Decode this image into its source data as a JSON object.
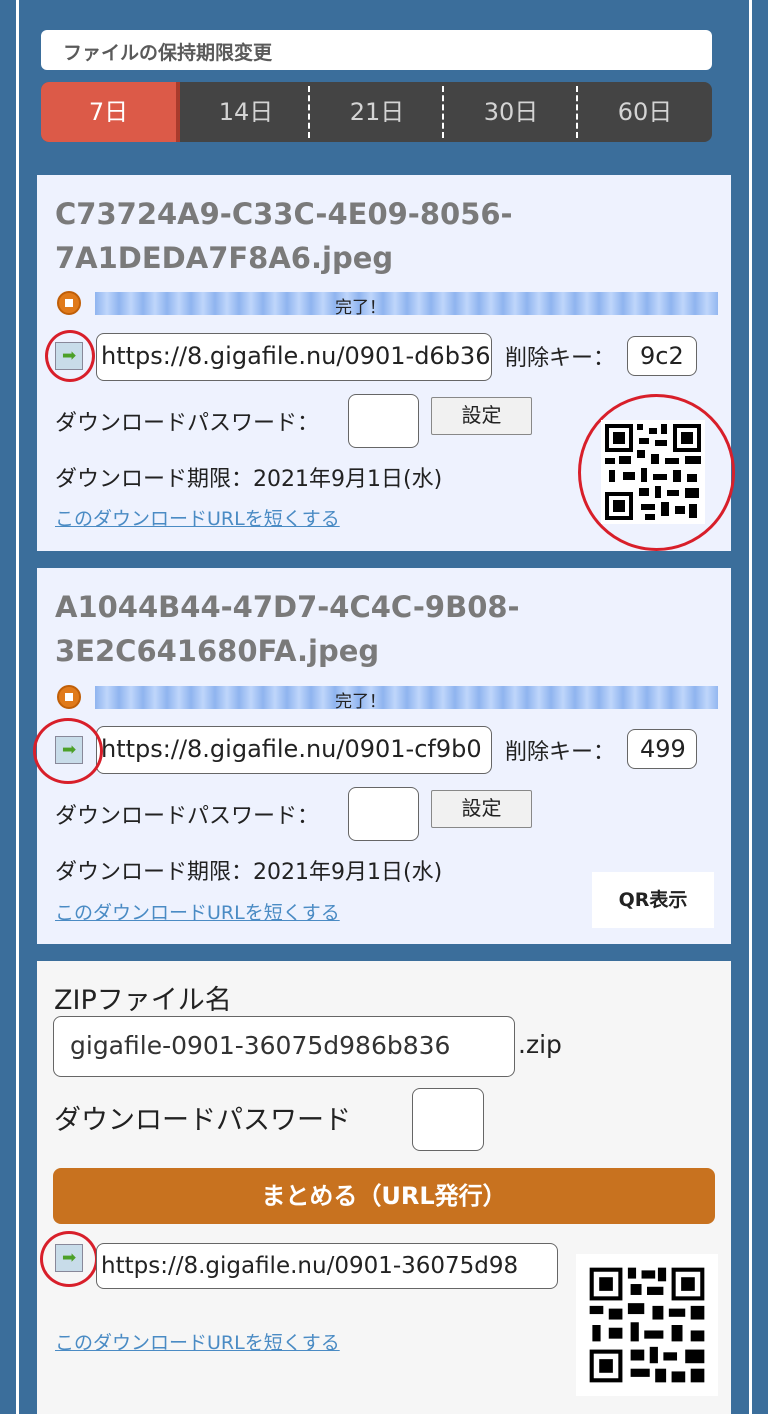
{
  "retention": {
    "title": "ファイルの保持期限変更",
    "tabs": [
      "7日",
      "14日",
      "21日",
      "30日",
      "60日"
    ],
    "selected": "7日"
  },
  "files": [
    {
      "name_line1": "C73724A9-C33C-4E09-8056-",
      "name_line2": "7A1DEDA7F8A6.jpeg",
      "progress_text": "完了！",
      "url": "https://8.gigafile.nu/0901-d6b36",
      "delete_key_label": "削除キー：",
      "delete_key": "9c2",
      "password_label": "ダウンロードパスワード：",
      "set_button": "設定",
      "expiry": "ダウンロード期限：2021年9月1日(水)",
      "shorten_link": "このダウンロードURLを短くする",
      "qr_icon": "qr-code"
    },
    {
      "name_line1": "A1044B44-47D7-4C4C-9B08-",
      "name_line2": "3E2C641680FA.jpeg",
      "progress_text": "完了！",
      "url": "https://8.gigafile.nu/0901-cf9b0",
      "delete_key_label": "削除キー：",
      "delete_key": "499",
      "password_label": "ダウンロードパスワード：",
      "set_button": "設定",
      "expiry": "ダウンロード期限：2021年9月1日(水)",
      "shorten_link": "このダウンロードURLを短くする",
      "qr_button": "QR表示"
    }
  ],
  "zip": {
    "label": "ZIPファイル名",
    "filename": "gigafile-0901-36075d986b836",
    "ext": ".zip",
    "password_label": "ダウンロードパスワード",
    "bundle_button": "まとめる（URL発行）",
    "url": "https://8.gigafile.nu/0901-36075d98",
    "shorten_link": "このダウンロードURLを短くする",
    "qr_icon": "qr-code"
  },
  "colors": {
    "background": "#3b6e9b",
    "selected_tab": "#dc5a48",
    "tab_bar": "#444444",
    "bundle_button": "#c8721f",
    "annotation_circle": "#d81f2a",
    "link": "#4a8bc4"
  }
}
